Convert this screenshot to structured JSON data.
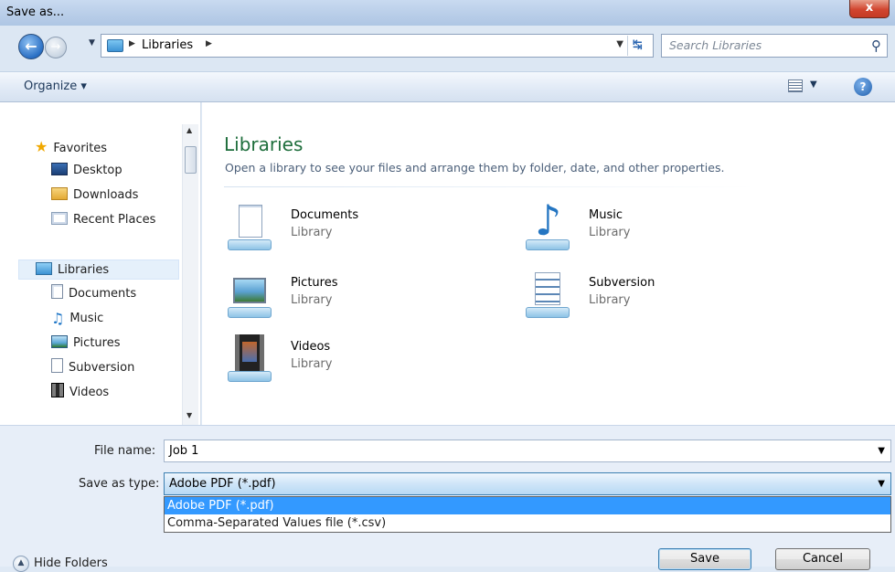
{
  "window": {
    "title": "Save as...",
    "close_label": "x"
  },
  "address": {
    "crumbs": [
      "Libraries"
    ],
    "search_placeholder": "Search Libraries"
  },
  "toolbar": {
    "organize_label": "Organize ▾"
  },
  "nav": {
    "favorites_label": "Favorites",
    "favorites": [
      {
        "label": "Desktop",
        "icon": "desktop-icon"
      },
      {
        "label": "Downloads",
        "icon": "downloads-icon"
      },
      {
        "label": "Recent Places",
        "icon": "recent-places-icon"
      }
    ],
    "libraries_label": "Libraries",
    "libraries": [
      {
        "label": "Documents",
        "icon": "documents-icon"
      },
      {
        "label": "Music",
        "icon": "music-icon"
      },
      {
        "label": "Pictures",
        "icon": "pictures-icon"
      },
      {
        "label": "Subversion",
        "icon": "subversion-icon"
      },
      {
        "label": "Videos",
        "icon": "videos-icon"
      }
    ]
  },
  "content": {
    "title": "Libraries",
    "subtitle": "Open a library to see your files and arrange them by folder, date, and other properties.",
    "libraries": [
      {
        "name": "Documents",
        "kind": "Library",
        "icon": "documents-library-icon"
      },
      {
        "name": "Music",
        "kind": "Library",
        "icon": "music-library-icon"
      },
      {
        "name": "Pictures",
        "kind": "Library",
        "icon": "pictures-library-icon"
      },
      {
        "name": "Subversion",
        "kind": "Library",
        "icon": "subversion-library-icon"
      },
      {
        "name": "Videos",
        "kind": "Library",
        "icon": "videos-library-icon"
      }
    ]
  },
  "form": {
    "file_name_label": "File name:",
    "file_name_value": "Job 1",
    "save_type_label": "Save as type:",
    "save_type_value": "Adobe PDF (*.pdf)",
    "save_type_options": [
      "Adobe PDF (*.pdf)",
      "Comma-Separated Values file (*.csv)"
    ],
    "selected_option_index": 0
  },
  "footer": {
    "hide_folders_label": "Hide Folders",
    "save_label": "Save",
    "cancel_label": "Cancel"
  },
  "colors": {
    "accent": "#3399ff",
    "library_title": "#1e6e3c",
    "close_button": "#c43a24"
  }
}
